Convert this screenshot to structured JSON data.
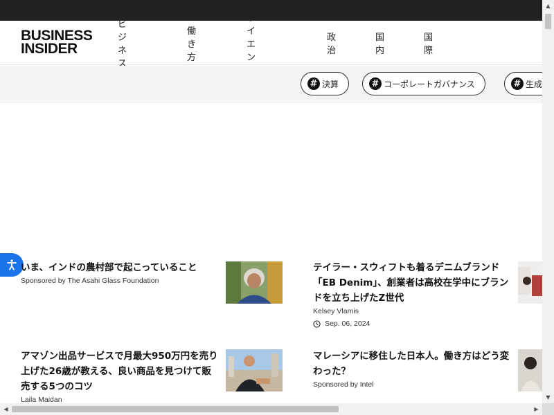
{
  "header": {
    "logo_line1": "BUSINESS",
    "logo_line2": "INSIDER",
    "nav": [
      "ビジネス",
      "働き方",
      "サイエンス",
      "政治",
      "国内",
      "国際"
    ]
  },
  "tags": [
    {
      "hash": "#",
      "label": "決算"
    },
    {
      "hash": "#",
      "label": "コーポレートガバナンス"
    },
    {
      "hash": "#",
      "label": "生成"
    }
  ],
  "articles": [
    {
      "title": "いま、インドの農村部で起こっていること",
      "byline": "Sponsored by The Asahi Glass Foundation"
    },
    {
      "title": "テイラー・スウィフトも着るデニムブランド「EB Denim」、創業者は高校在学中にブランドを立ち上げたZ世代",
      "byline": "Kelsey Vlamis",
      "date": "Sep. 06, 2024"
    },
    {
      "title": "アマゾン出品サービスで月最大950万円を売り上げた26歳が教える、良い商品を見つけて販売する5つのコツ",
      "byline": "Laila Maidan"
    },
    {
      "title": "マレーシアに移住した日本人。働き方はどう変わった？",
      "byline": "Sponsored by Intel"
    }
  ],
  "colors": {
    "topbar": "#222222",
    "accessibility_button": "#1a73e8",
    "tagbar_bg": "#f4f4f4"
  },
  "icons": {
    "accessibility": "accessibility-icon",
    "clock": "clock-icon"
  }
}
